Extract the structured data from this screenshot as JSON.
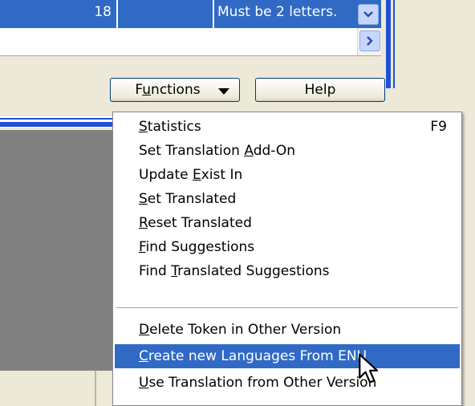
{
  "grid": {
    "row_number": "18",
    "message": "Must be 2 letters."
  },
  "buttons": {
    "functions": {
      "pre": "F",
      "acc": "u",
      "post": "nctions"
    },
    "help": "Help"
  },
  "menu": {
    "items": [
      {
        "pre": "",
        "acc": "S",
        "post": "tatistics",
        "shortcut": "F9"
      },
      {
        "pre": "Set Translation ",
        "acc": "A",
        "post": "dd-On"
      },
      {
        "pre": "Update ",
        "acc": "E",
        "post": "xist In"
      },
      {
        "pre": "",
        "acc": "S",
        "post": "et Translated"
      },
      {
        "pre": "",
        "acc": "R",
        "post": "eset Translated"
      },
      {
        "pre": "",
        "acc": "F",
        "post": "ind Suggestions"
      },
      {
        "pre": "Find ",
        "acc": "T",
        "post": "ranslated Suggestions"
      },
      {
        "pre": "",
        "acc": "D",
        "post": "elete Token in Other Version"
      },
      {
        "pre": "",
        "acc": "C",
        "post": "reate new Languages From ENU"
      },
      {
        "pre": "",
        "acc": "U",
        "post": "se Translation from Other Version"
      }
    ],
    "highlighted_index": 8
  },
  "icons": {
    "dropdown": "chevron-down-icon",
    "scroll_right": "chevron-right-icon",
    "functions_arrow": "caret-down-icon",
    "cursor": "mouse-pointer-icon"
  },
  "colors": {
    "selection": "#316ac5",
    "accent_blue": "#2050d8",
    "button_border": "#003c74"
  }
}
